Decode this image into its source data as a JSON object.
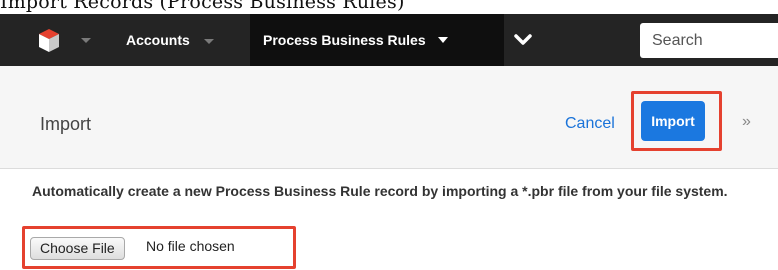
{
  "top_text": "Import Records (Process Business Rules)",
  "navbar": {
    "modules": [
      {
        "label": "Accounts"
      },
      {
        "label": "Process Business Rules"
      }
    ],
    "search": {
      "placeholder": "Search"
    }
  },
  "header": {
    "title": "Import",
    "cancel_label": "Cancel",
    "import_label": "Import",
    "more_symbol": "»"
  },
  "main": {
    "description": "Automatically create a new Process Business Rule record by importing a *.pbr file from your file system.",
    "file_input": {
      "button_label": "Choose File",
      "status": "No file chosen"
    }
  },
  "colors": {
    "navbar": "#242424",
    "active_tab": "#0f0f0f",
    "primary_button": "#1b78e0",
    "link": "#1a73d9",
    "highlight": "#e5412f"
  },
  "icons": [
    "logo-cube-icon",
    "chevron-down-icon",
    "more-chevron-icon",
    "double-chevron-right-icon"
  ]
}
